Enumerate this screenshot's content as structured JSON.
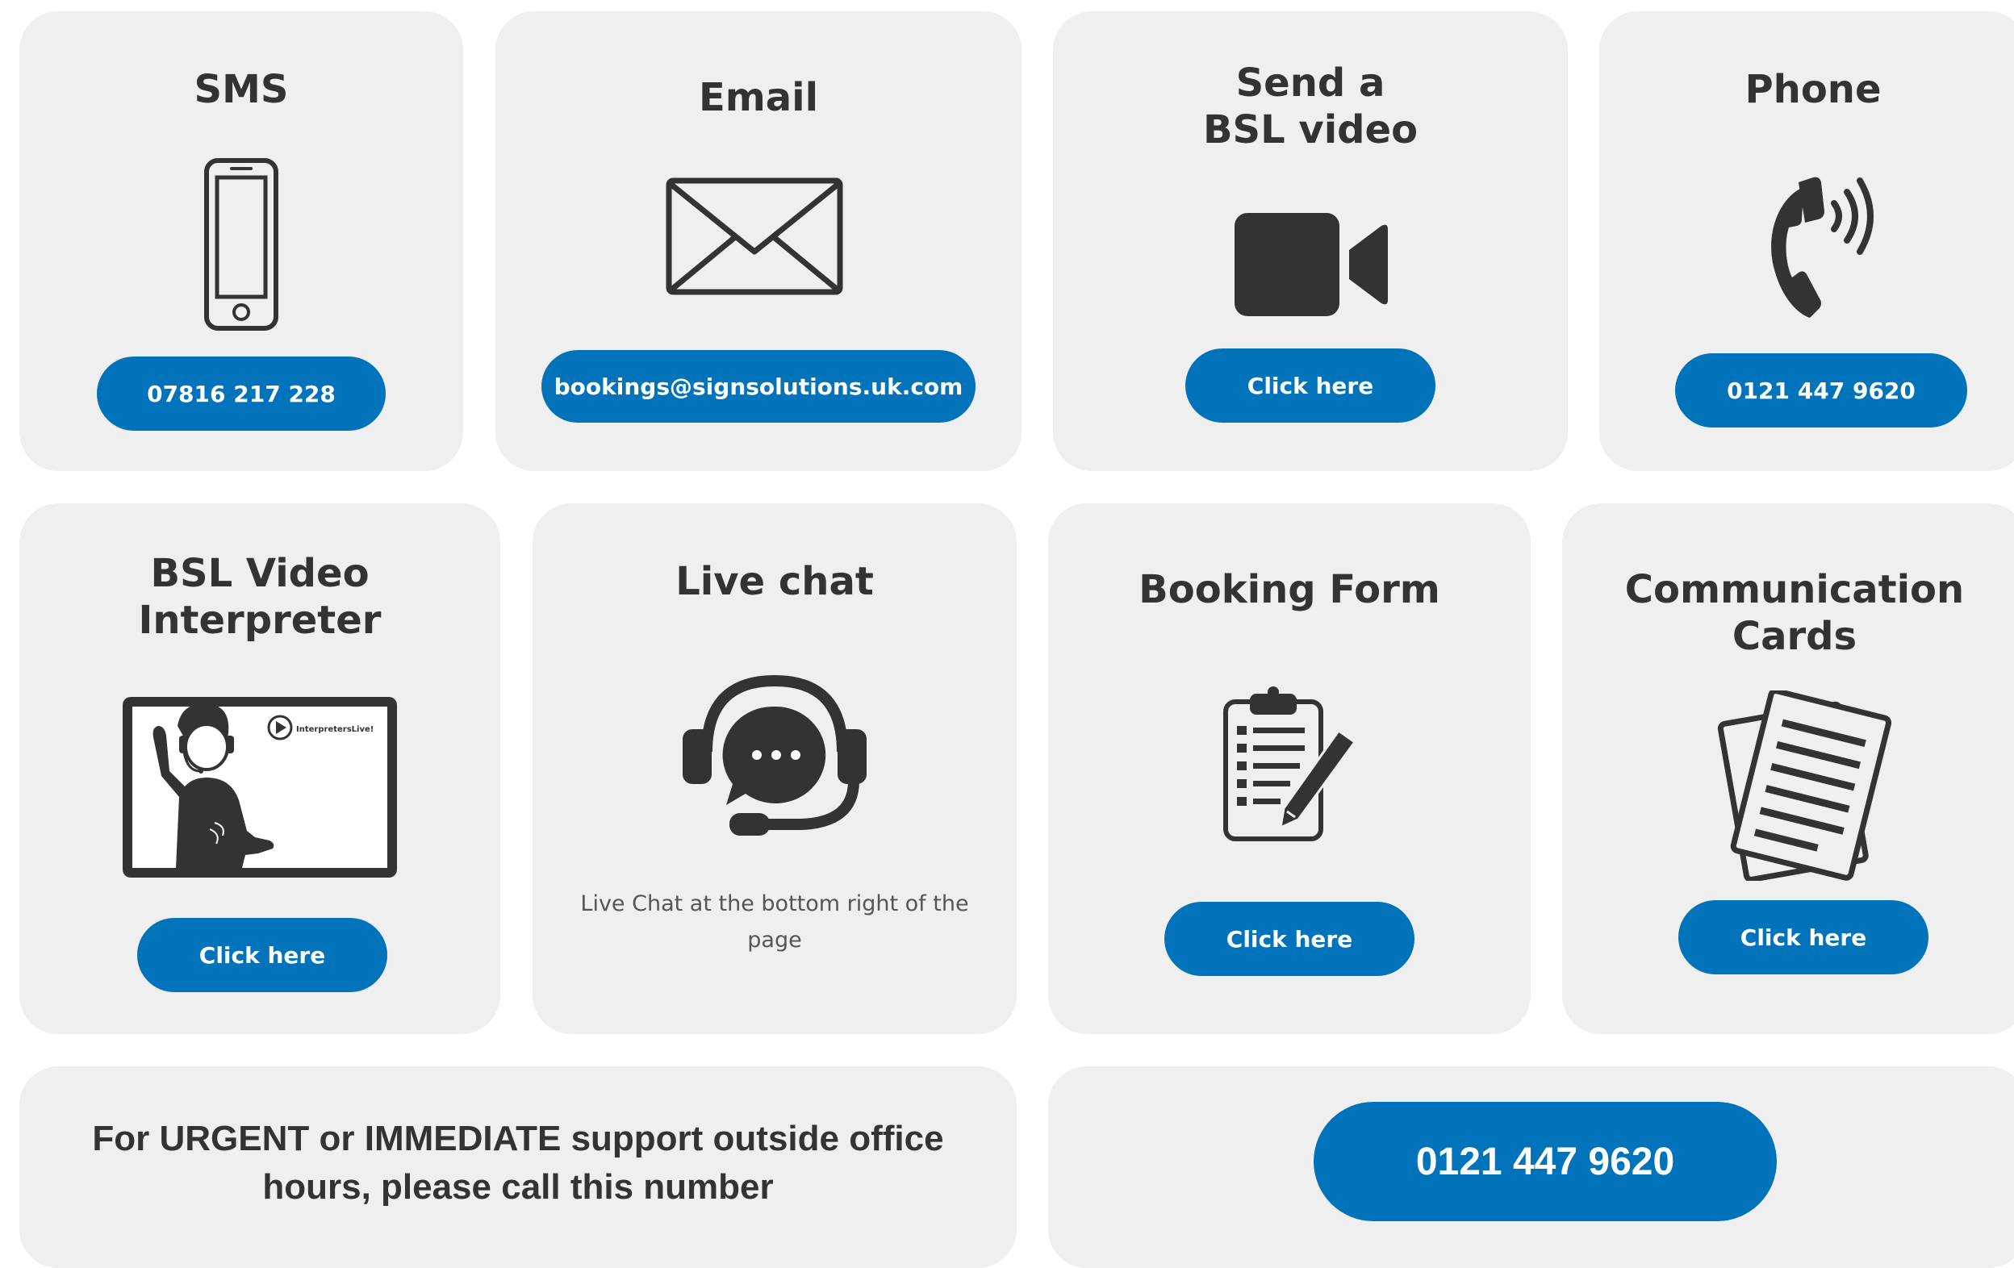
{
  "accent_color": "#0073bb",
  "card_background": "#efefef",
  "cards": {
    "sms": {
      "title": "SMS",
      "button": "07816 217 228",
      "icon": "smartphone-icon"
    },
    "email": {
      "title": "Email",
      "button": "bookings@signsolutions.uk.com",
      "icon": "envelope-icon"
    },
    "bsl_video": {
      "title": "Send a\nBSL video",
      "button": "Click here",
      "icon": "video-camera-icon"
    },
    "phone": {
      "title": "Phone",
      "button": "0121 447 9620",
      "icon": "phone-ringing-icon"
    },
    "video_interpreter": {
      "title": "BSL Video\nInterpreter",
      "button": "Click here",
      "icon": "video-interpreter-tablet-icon",
      "logo_text": "InterpretersLive!"
    },
    "live_chat": {
      "title": "Live chat",
      "note": "Live Chat at the bottom right of the page",
      "icon": "headset-chat-icon"
    },
    "booking_form": {
      "title": "Booking Form",
      "button": "Click here",
      "icon": "clipboard-pencil-icon"
    },
    "communication_cards": {
      "title": "Communication\nCards",
      "button": "Click here",
      "icon": "documents-icon"
    }
  },
  "urgent": {
    "text": "For URGENT or IMMEDIATE support outside office hours, please call this number",
    "phone_button": "0121 447 9620"
  }
}
